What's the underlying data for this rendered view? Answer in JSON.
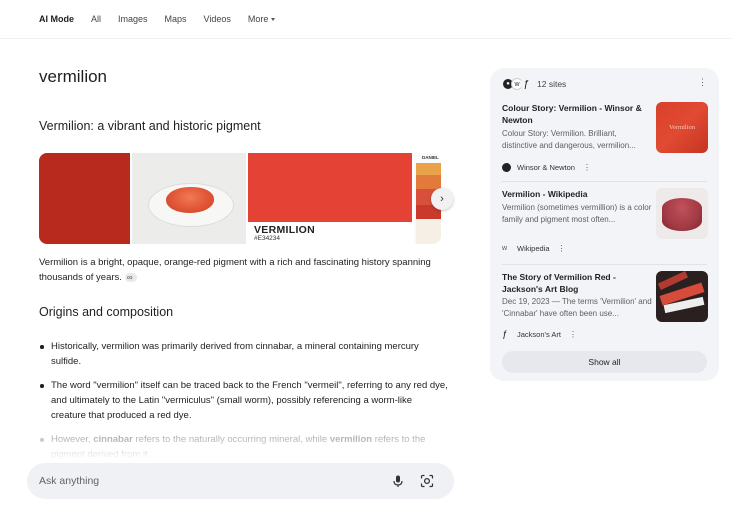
{
  "nav": {
    "tabs": [
      "AI Mode",
      "All",
      "Images",
      "Maps",
      "Videos"
    ],
    "more_label": "More"
  },
  "query": "vermilion",
  "answer": {
    "heading": "Vermilion: a vibrant and historic pigment",
    "image_strip": {
      "swatch_name": "VERMILION",
      "swatch_hex": "#E34234",
      "palette_label": "DANIEL",
      "next_icon": "chevron-right-icon"
    },
    "intro": "Vermilion is a bright, opaque, orange-red pigment with a rich and fascinating history spanning thousands of years.",
    "section2_heading": "Origins and composition",
    "bullets": [
      "Historically, vermilion was primarily derived from cinnabar, a mineral containing mercury sulfide.",
      "The word \"vermilion\" itself can be traced back to the French \"vermeil\", referring to any red dye, and ultimately to the Latin \"vermiculus\" (small worm), possibly referencing a worm-like creature that produced a red dye."
    ],
    "faded_bullet": {
      "pre": "However, ",
      "b1": "cinnabar",
      "mid": " refers to the naturally occurring mineral, while ",
      "b2": "vermilion",
      "post": " refers to the pigment derived from it."
    }
  },
  "ask": {
    "placeholder": "Ask anything",
    "mic_icon": "microphone-icon",
    "lens_icon": "lens-icon"
  },
  "sources": {
    "count_label": "12 sites",
    "items": [
      {
        "title": "Colour Story: Vermilion - Winsor & Newton",
        "snippet": "Colour Story: Vermilion. Brilliant, distinctive and dangerous, vermilion...",
        "site": "Winsor & Newton",
        "thumb_text": "Vermilion"
      },
      {
        "title": "Vermilion - Wikipedia",
        "snippet": "Vermilion (sometimes vermillion) is a color family and pigment most often...",
        "site": "Wikipedia"
      },
      {
        "title": "The Story of Vermilion Red - Jackson's Art Blog",
        "snippet": "Dec 19, 2023 — The terms 'Vermilion' and 'Cinnabar' have often been use...",
        "site": "Jackson's Art"
      }
    ],
    "show_all_label": "Show all"
  },
  "colors": {
    "vermilion": "#E34234",
    "panel_bg": "#f3f4f8",
    "askbar_bg": "#f0f1f4"
  }
}
